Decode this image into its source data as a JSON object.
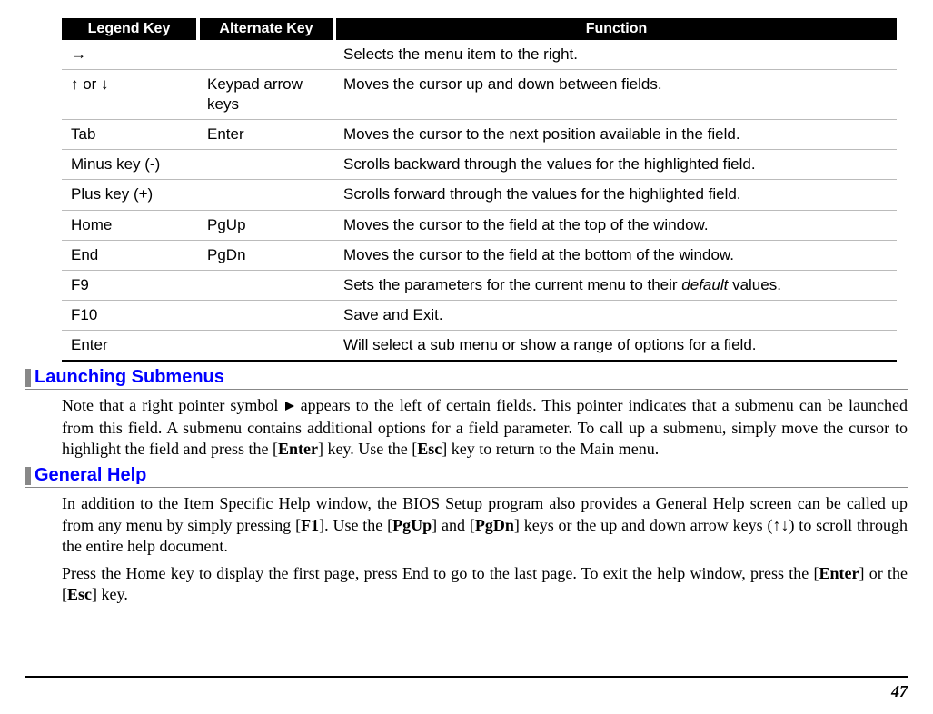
{
  "table": {
    "headers": {
      "legend": "Legend Key",
      "alternate": "Alternate Key",
      "function": "Function"
    },
    "rows": [
      {
        "legend": "→",
        "alternate": "",
        "function": "Selects the menu item to the right."
      },
      {
        "legend": "↑ or ↓",
        "alternate": "Keypad arrow keys",
        "function": "Moves the cursor up and down between fields."
      },
      {
        "legend": "Tab",
        "alternate": "Enter",
        "function": "Moves the cursor to the next position available in the field."
      },
      {
        "legend": "Minus key (-)",
        "alternate": "",
        "function": "Scrolls backward through the values for the highlighted field."
      },
      {
        "legend": "Plus key (+)",
        "alternate": "",
        "function": "Scrolls forward through the values for the highlighted field."
      },
      {
        "legend": "Home",
        "alternate": "PgUp",
        "function": "Moves the cursor to the field at the top of the window."
      },
      {
        "legend": "End",
        "alternate": "PgDn",
        "function": "Moves the cursor to the field at the bottom of the window."
      },
      {
        "legend": "F9",
        "alternate": "",
        "function_pre": "Sets the parameters for the current menu to their ",
        "function_italic": "default",
        "function_post": " values."
      },
      {
        "legend": "F10",
        "alternate": "",
        "function": "Save and Exit."
      },
      {
        "legend": "Enter",
        "alternate": "",
        "function": "Will select a sub menu or show a range of options for a field."
      }
    ]
  },
  "sections": {
    "submenus": {
      "title": "Launching Submenus",
      "p1_a": "Note that a right pointer symbol ",
      "p1_b": " appears to the left of certain fields. This pointer indicates that a submenu can be launched from this field. A submenu contains additional options for a field parameter. To call up a submenu, simply move the cursor to highlight the field and press the [",
      "p1_enter": "Enter",
      "p1_c": "] key. Use the [",
      "p1_esc": "Esc",
      "p1_d": "] key to return to the Main menu."
    },
    "help": {
      "title": "General Help",
      "p1_a": "In addition to the Item Specific Help window, the BIOS Setup program also provides a General Help screen can be called up from any menu by simply pressing [",
      "p1_f1": "F1",
      "p1_b": "]. Use the [",
      "p1_pgup": "PgUp",
      "p1_c": "] and [",
      "p1_pgdn": "PgDn",
      "p1_d": "] keys or the up and down arrow keys (↑↓) to scroll through the entire help document.",
      "p2_a": "Press the Home key to display the first page, press End to go to the last page. To exit the help window, press the [",
      "p2_enter": "Enter",
      "p2_b": "] or the [",
      "p2_esc": "Esc",
      "p2_c": "] key."
    }
  },
  "page_number": "47"
}
